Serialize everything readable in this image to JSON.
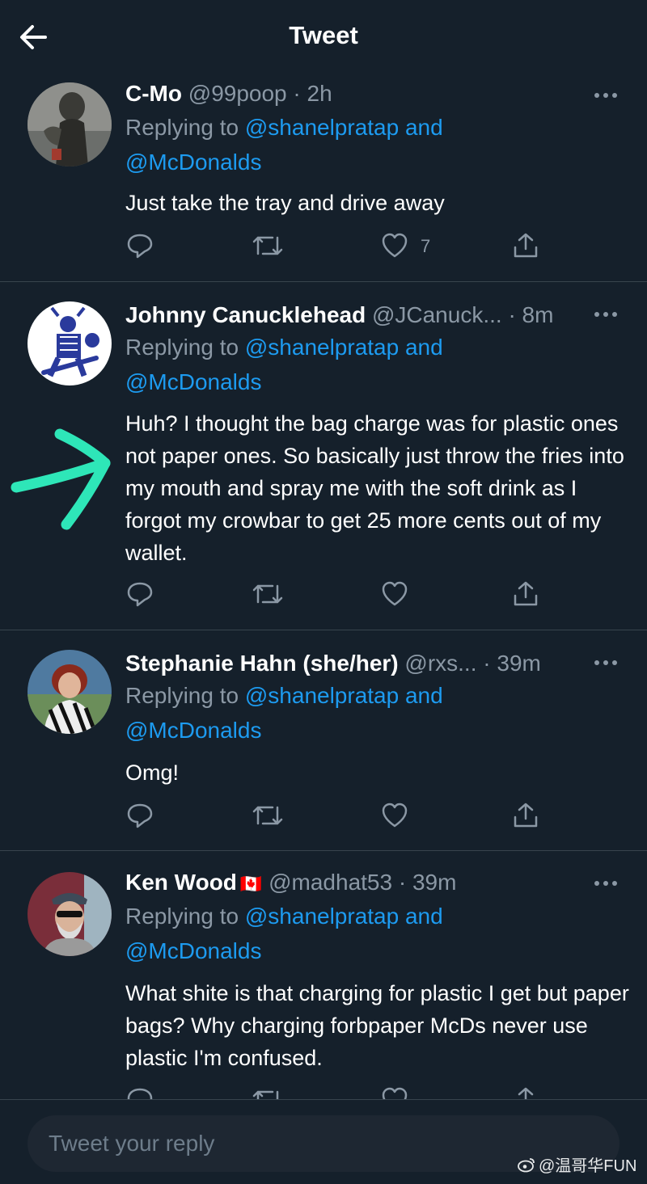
{
  "header": {
    "title": "Tweet"
  },
  "tweets": [
    {
      "name": "C-Mo",
      "handle": "@99poop",
      "time": "· 2h",
      "replying_prefix": "Replying to",
      "mention1": "@shanelpratap",
      "and": "and",
      "mention2": "@McDonalds",
      "text": "Just take the tray and drive away",
      "like_count": "7"
    },
    {
      "name": "Johnny Canucklehead",
      "handle": "@JCanuck...",
      "time": "· 8m",
      "replying_prefix": "Replying to",
      "mention1": "@shanelpratap",
      "and": "and",
      "mention2": "@McDonalds",
      "text": "Huh? I thought the bag charge was for plastic ones not paper ones. So basically just throw the fries into my mouth and spray me with the soft drink as I forgot my crowbar to get 25 more cents out of my wallet.",
      "like_count": ""
    },
    {
      "name": "Stephanie Hahn (she/her)",
      "handle": "@rxs...",
      "time": "· 39m",
      "replying_prefix": "Replying to",
      "mention1": "@shanelpratap",
      "and": "and",
      "mention2": "@McDonalds",
      "text": "Omg!",
      "like_count": ""
    },
    {
      "name": "Ken Wood",
      "flag": "🇨🇦",
      "handle": "@madhat53",
      "time": "· 39m",
      "replying_prefix": "Replying to",
      "mention1": "@shanelpratap",
      "and": "and",
      "mention2": "@McDonalds",
      "text": "What shite is that charging for plastic I get but paper bags? Why charging forbpaper McDs never use plastic I'm confused.",
      "like_count": ""
    }
  ],
  "composer": {
    "placeholder": "Tweet your reply"
  },
  "watermark": "@温哥华FUN",
  "colors": {
    "background": "#15202b",
    "accent": "#1d9bf0",
    "muted": "#8b98a5",
    "arrow": "#2ee6b8"
  },
  "icons": [
    "back-arrow-icon",
    "more-icon",
    "reply-icon",
    "retweet-icon",
    "like-icon",
    "share-icon",
    "weibo-icon"
  ]
}
